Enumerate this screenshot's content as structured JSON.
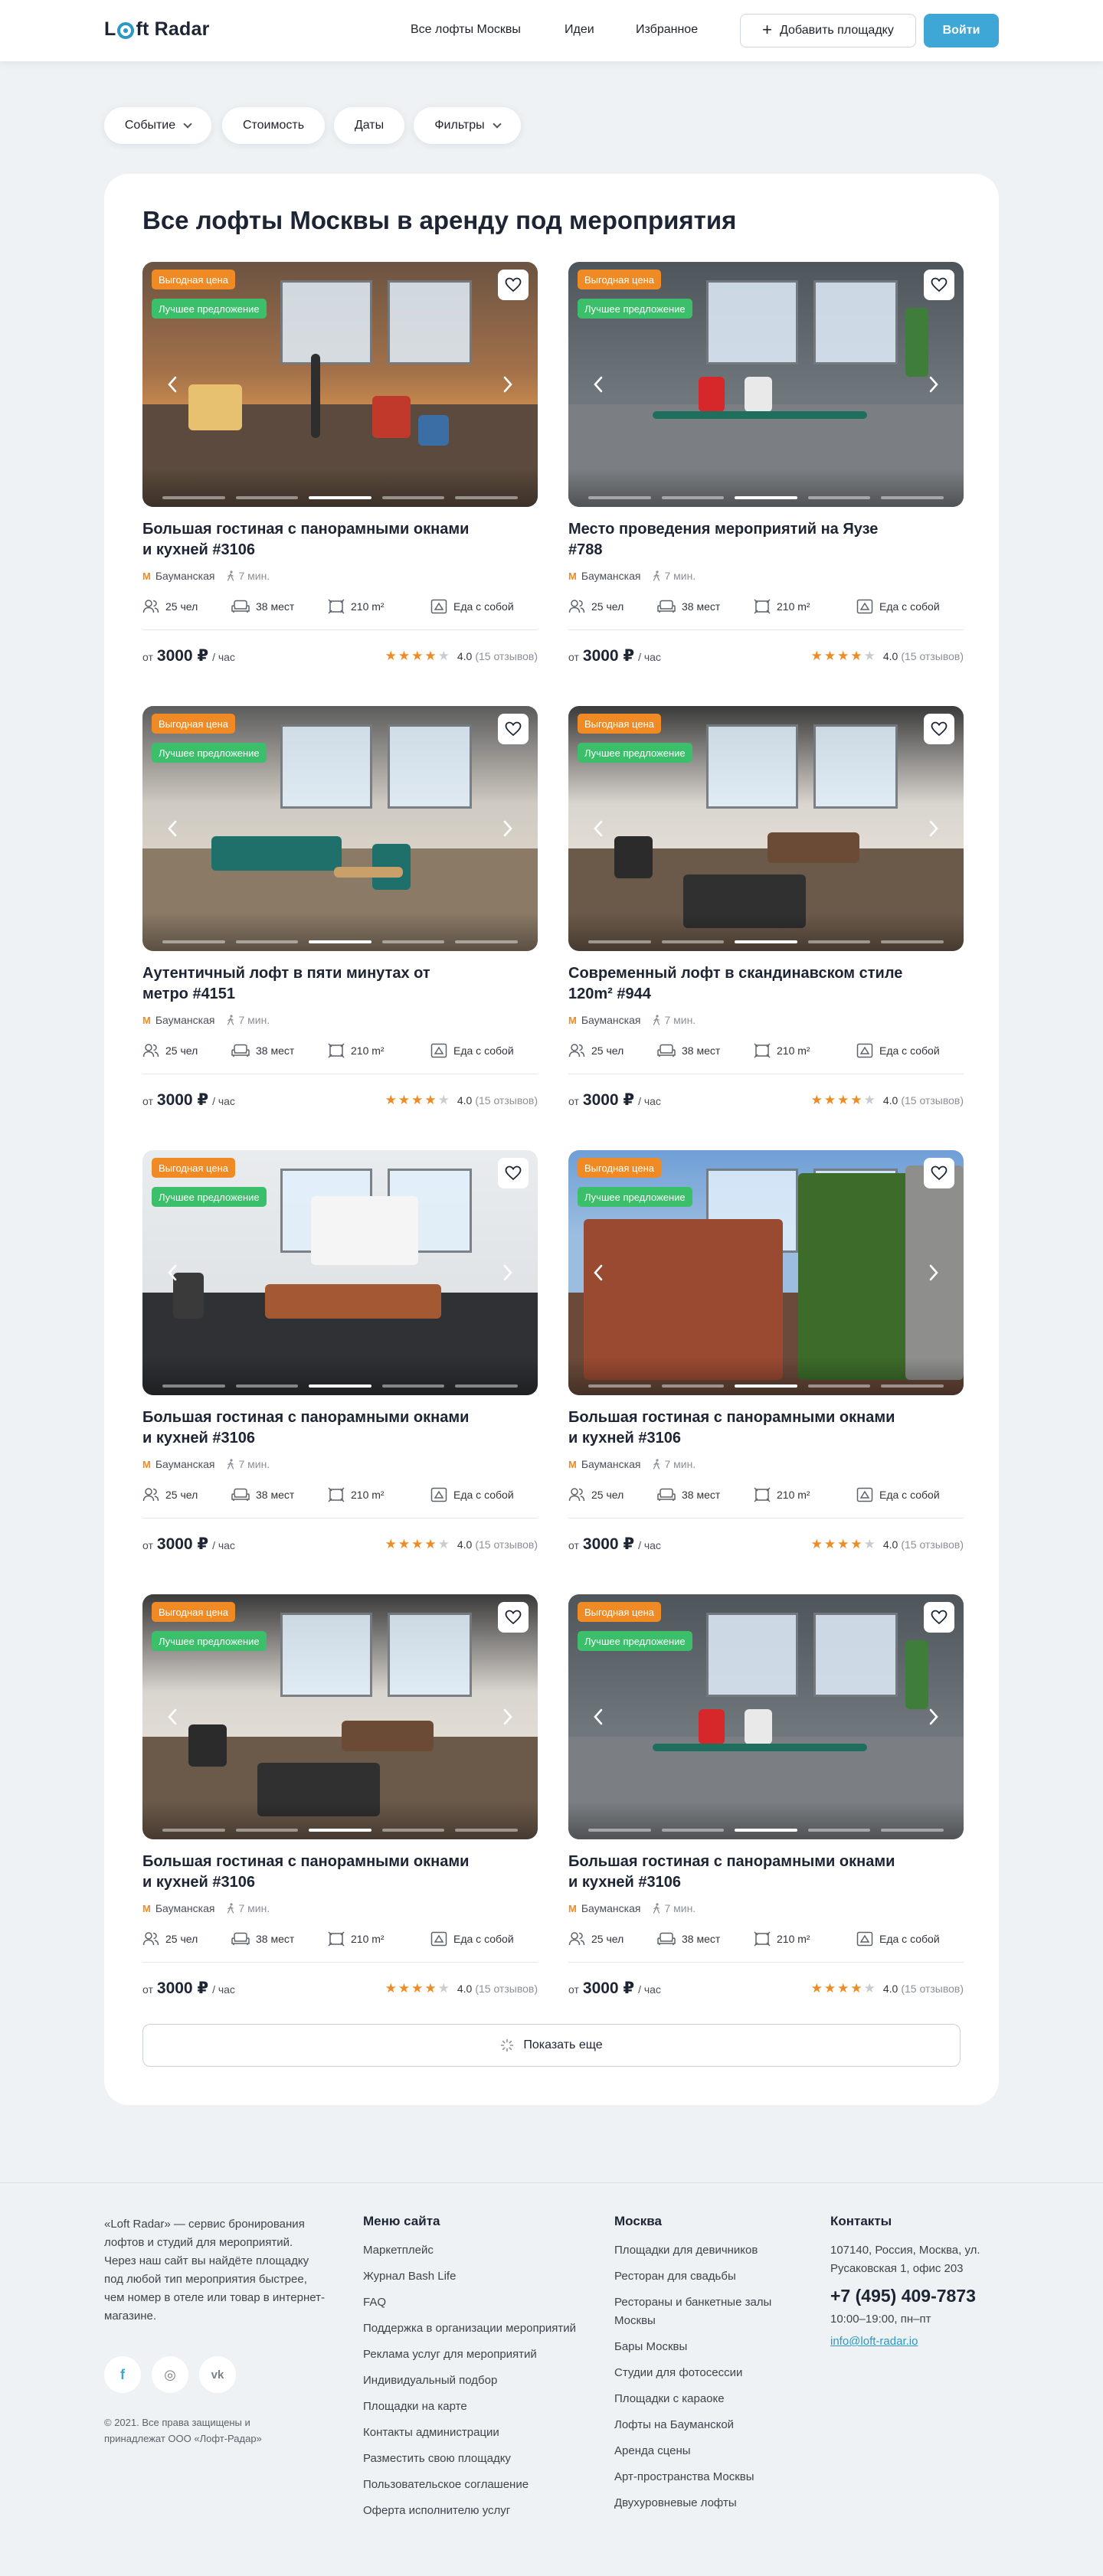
{
  "header": {
    "logo_before": "L",
    "logo_after": "ft Radar",
    "nav": [
      "Все лофты Москвы",
      "Идеи",
      "Избранное"
    ],
    "add_label": "Добавить площадку",
    "login_label": "Войти"
  },
  "filters": [
    "Событие",
    "Стоимость",
    "Даты",
    "Фильтры"
  ],
  "page_title": "Все лофты Москвы в аренду под мероприятия",
  "common": {
    "badge_price": "Выгодная цена",
    "badge_best": "Лучшее предложение",
    "metro": "Бауманская",
    "walk": "7 мин.",
    "people": "25 чел",
    "seats": "38 мест",
    "area": "210 m²",
    "food": "Еда с собой",
    "price_from": "от",
    "price_value": "3000 ₽",
    "price_unit": "/ час",
    "rating": "4.0",
    "reviews": "(15 отзывов)",
    "stars_filled": 4,
    "stars_total": 5
  },
  "listings": [
    {
      "title": "Большая гостиная с панорамными окнами и кухней #3106",
      "scene": "warm",
      "active_dot": 2
    },
    {
      "title": "Место проведения мероприятий на Яузе #788",
      "scene": "office",
      "active_dot": 2
    },
    {
      "title": "Аутентичный лофт в пяти минутах от метро #4151",
      "scene": "teal",
      "active_dot": 2
    },
    {
      "title": "Современный лофт в скандинавском стиле 120m² #944",
      "scene": "scandi",
      "active_dot": 2
    },
    {
      "title": "Большая гостиная с панорамными окнами и кухней #3106",
      "scene": "kitchen",
      "active_dot": 2
    },
    {
      "title": "Большая гостиная с панорамными окнами и кухней #3106",
      "scene": "brick",
      "active_dot": 2
    },
    {
      "title": "Большая гостиная с панорамными окнами и кухней #3106",
      "scene": "scandi",
      "active_dot": 2
    },
    {
      "title": "Большая гостиная с панорамными окнами и кухней #3106",
      "scene": "office",
      "active_dot": 2
    }
  ],
  "show_more": "Показать еще",
  "footer": {
    "about": "«Loft Radar» — сервис бронирования лофтов и студий для мероприятий. Через наш сайт вы найдёте площадку под любой тип мероприятия быстрее, чем номер в отеле или товар в интернет-магазине.",
    "socials": [
      "f",
      "◎",
      "vk"
    ],
    "copyright": "© 2021. Все права защищены и принадлежат ООО «Лофт-Радар»",
    "menu_title": "Меню сайта",
    "menu": [
      "Маркетплейс",
      "Журнал Bash Life",
      "FAQ",
      "Поддержка в организации мероприятий",
      "Реклама услуг для мероприятий",
      "Индивидуальный подбор",
      "Площадки на карте",
      "Контакты администрации",
      "Разместить свою площадку",
      "Пользовательское соглашение",
      "Оферта исполнителю услуг"
    ],
    "moscow_title": "Москва",
    "moscow": [
      "Площадки для девичников",
      "Ресторан для свадьбы",
      "Рестораны и банкетные залы Москвы",
      "Бары Москвы",
      "Студии для фотосессии",
      "Площадки с караоке",
      "Лофты на Бауманской",
      "Аренда сцены",
      "Арт-пространства Москвы",
      "Двухуровневые лофты"
    ],
    "contacts_title": "Контакты",
    "address": "107140, Россия, Москва, ул. Русаковская 1, офис 203",
    "phone": "+7 (495) 409-7873",
    "hours": "10:00–19:00, пн–пт",
    "email": "info@loft-radar.io"
  },
  "colors": {
    "accent": "#3fa7d6",
    "orange": "#f08a24",
    "green": "#3bbf6a"
  }
}
